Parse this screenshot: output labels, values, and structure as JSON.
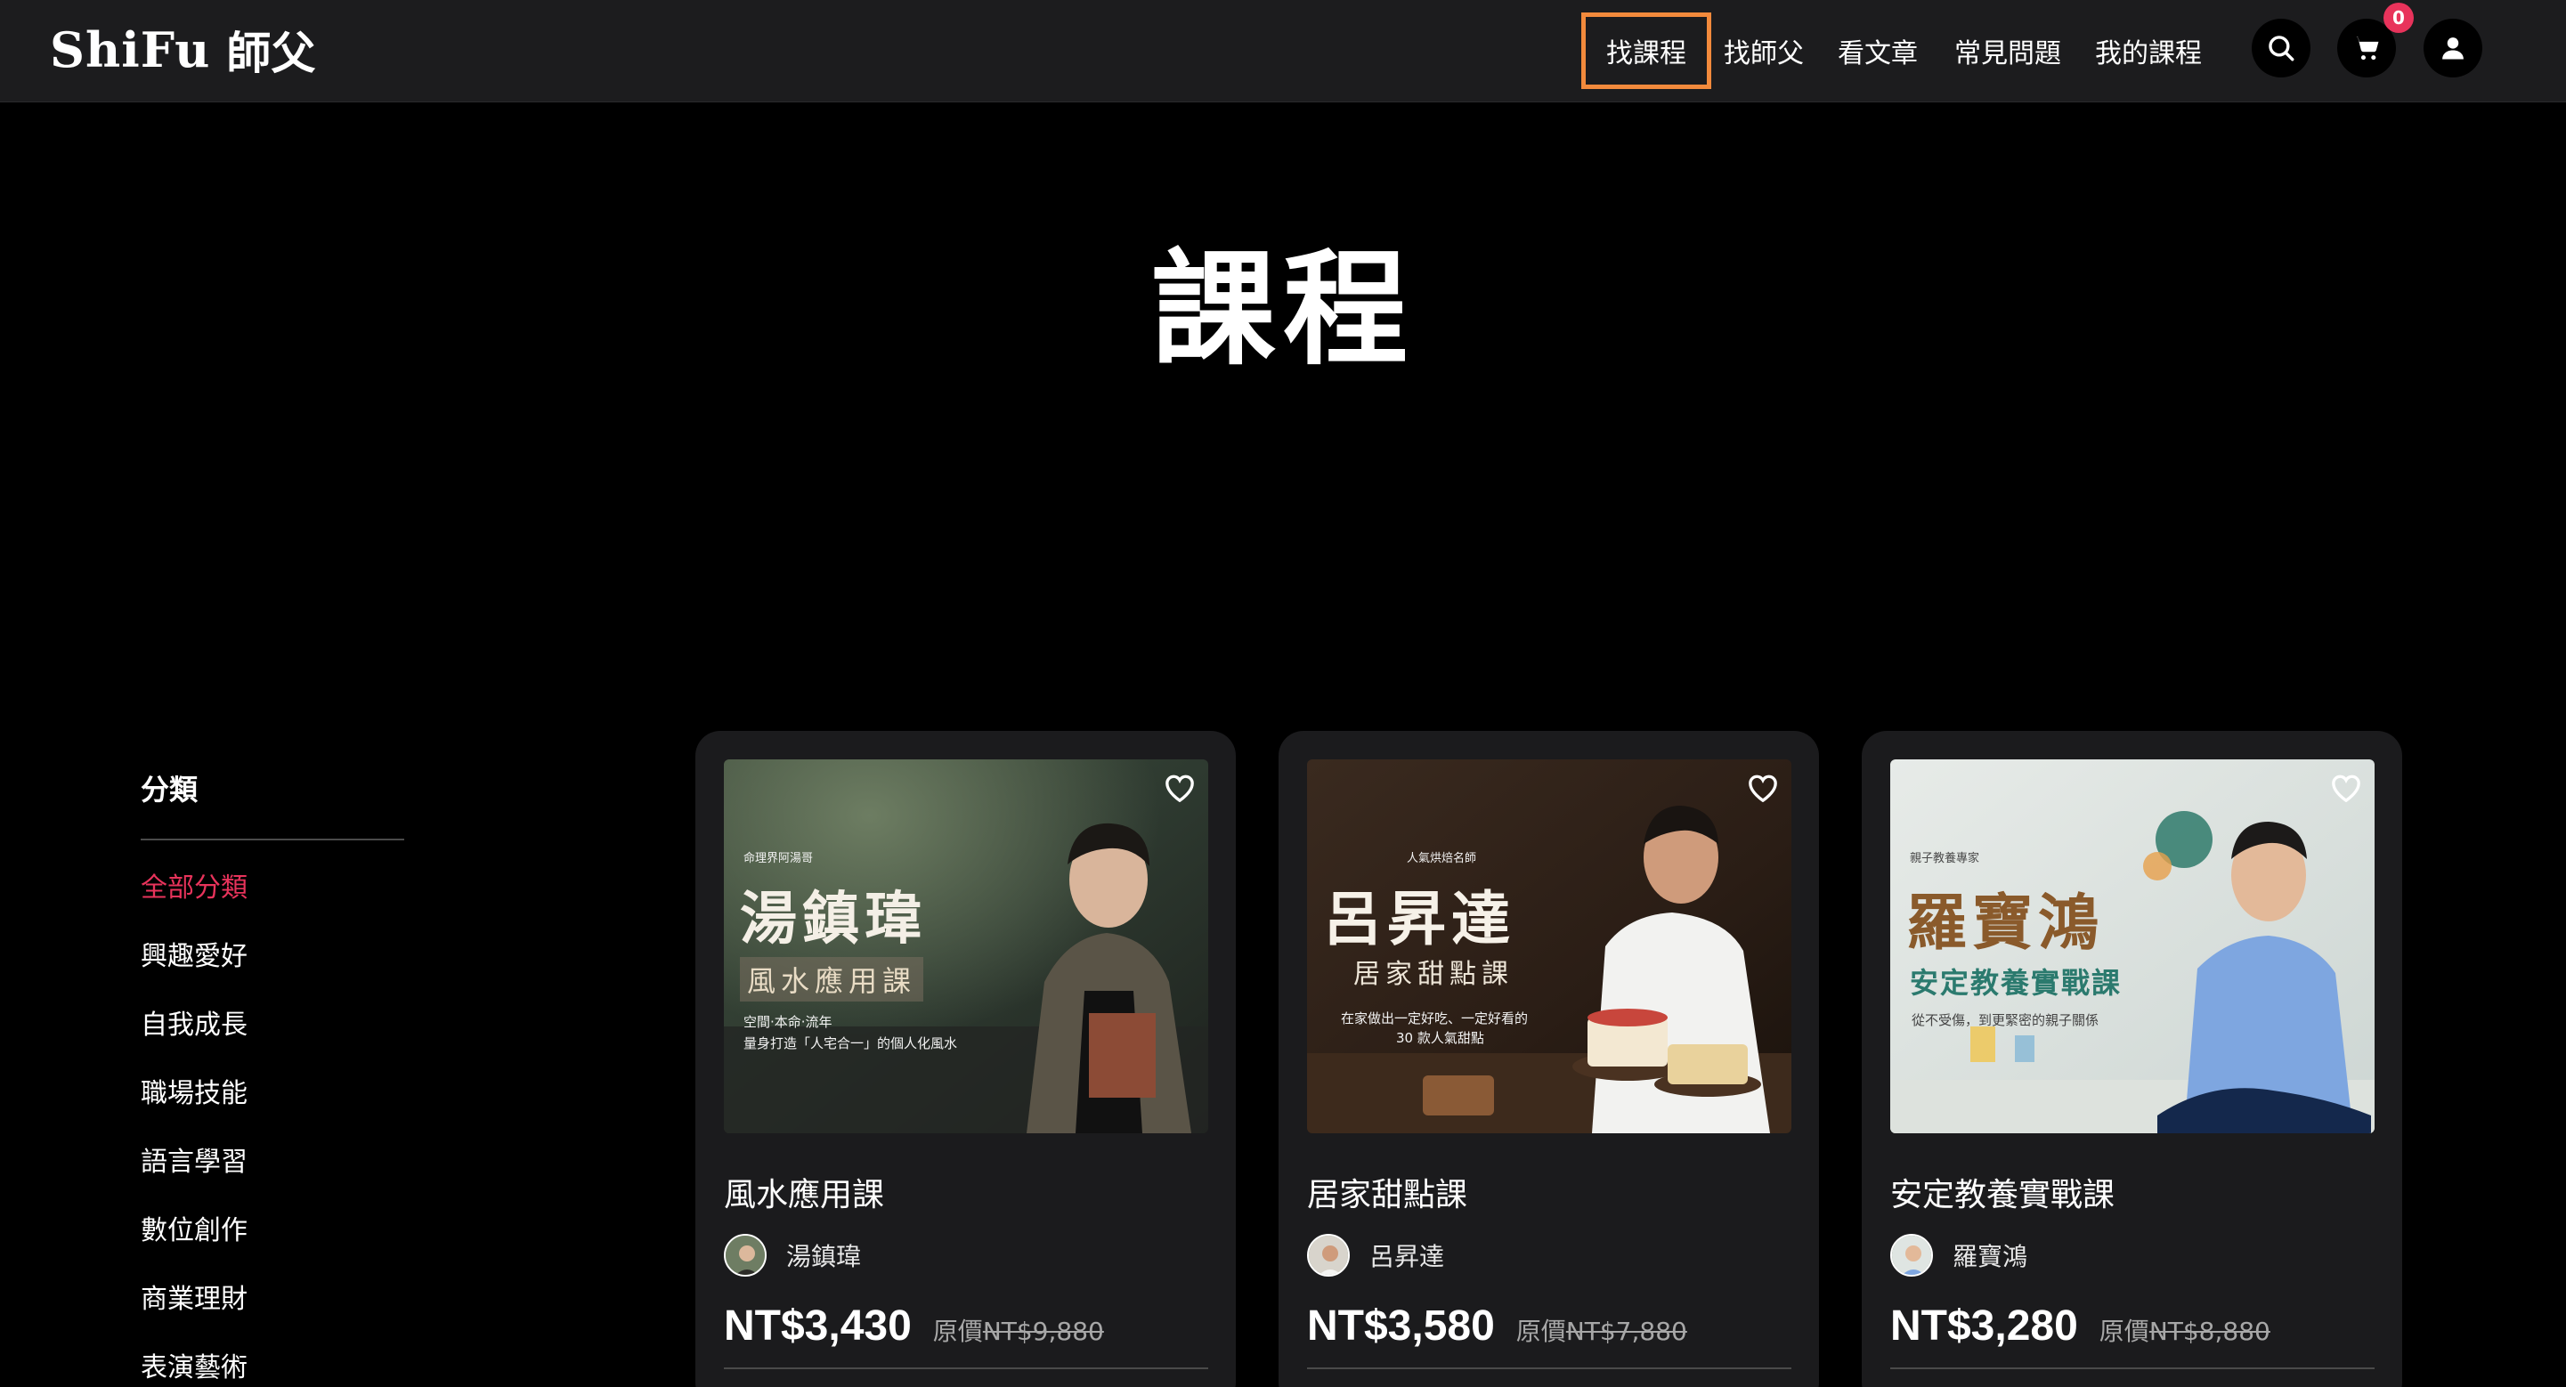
{
  "header": {
    "logo_latin": "ShiFu",
    "logo_cjk": "師父",
    "nav": [
      {
        "label": "找課程",
        "active": true
      },
      {
        "label": "找師父",
        "active": false
      },
      {
        "label": "看文章",
        "active": false
      },
      {
        "label": "常見問題",
        "active": false
      },
      {
        "label": "我的課程",
        "active": false
      }
    ],
    "cart_count": "0"
  },
  "page_title": "課程",
  "sidebar": {
    "heading": "分類",
    "items": [
      {
        "label": "全部分類",
        "active": true
      },
      {
        "label": "興趣愛好",
        "active": false
      },
      {
        "label": "自我成長",
        "active": false
      },
      {
        "label": "職場技能",
        "active": false
      },
      {
        "label": "語言學習",
        "active": false
      },
      {
        "label": "數位創作",
        "active": false
      },
      {
        "label": "商業理財",
        "active": false
      },
      {
        "label": "表演藝術",
        "active": false
      }
    ]
  },
  "courses": [
    {
      "title": "風水應用課",
      "instructor": "湯鎮瑋",
      "price": "NT$3,430",
      "original_label": "原價",
      "original_price": "NT$9,880",
      "poster": {
        "tag": "命理界阿湯哥",
        "name": "湯鎮瑋",
        "course": "風水應用課",
        "line1": "空間‧本命‧流年",
        "line2": "量身打造「人宅合一」的個人化風水"
      }
    },
    {
      "title": "居家甜點課",
      "instructor": "呂昇達",
      "price": "NT$3,580",
      "original_label": "原價",
      "original_price": "NT$7,880",
      "poster": {
        "tag": "人氣烘焙名師",
        "name": "呂昇達",
        "course": "居家甜點課",
        "line1": "在家做出一定好吃、一定好看的",
        "line2": "30 款人氣甜點"
      }
    },
    {
      "title": "安定教養實戰課",
      "instructor": "羅寶鴻",
      "price": "NT$3,280",
      "original_label": "原價",
      "original_price": "NT$8,880",
      "poster": {
        "tag": "親子教養專家",
        "name": "羅寶鴻",
        "course": "安定教養實戰課",
        "line1": "從不受傷，到更緊密的親子關係"
      }
    }
  ],
  "colors": {
    "accent_pink": "#e8335b",
    "highlight_orange": "#f28a3c",
    "header_bg": "#1c1c1e",
    "card_bg": "#1b1b1d"
  },
  "icons": [
    "search-icon",
    "cart-icon",
    "user-icon",
    "heart-icon"
  ]
}
